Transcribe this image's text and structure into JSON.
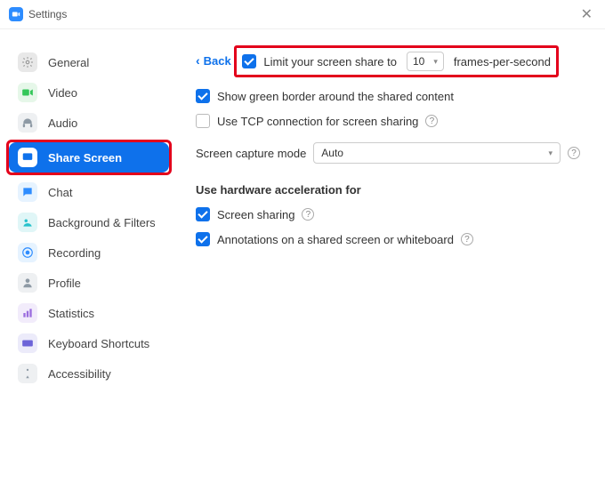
{
  "window": {
    "title": "Settings"
  },
  "sidebar": {
    "items": [
      {
        "label": "General"
      },
      {
        "label": "Video"
      },
      {
        "label": "Audio"
      },
      {
        "label": "Share Screen"
      },
      {
        "label": "Chat"
      },
      {
        "label": "Background & Filters"
      },
      {
        "label": "Recording"
      },
      {
        "label": "Profile"
      },
      {
        "label": "Statistics"
      },
      {
        "label": "Keyboard Shortcuts"
      },
      {
        "label": "Accessibility"
      }
    ]
  },
  "content": {
    "back": "Back",
    "limit_prefix": "Limit your screen share to",
    "limit_value": "10",
    "limit_suffix": "frames-per-second",
    "green_border": "Show green border around the shared content",
    "use_tcp": "Use TCP connection for screen sharing",
    "capture_mode_label": "Screen capture mode",
    "capture_mode_value": "Auto",
    "hw_accel_header": "Use hardware acceleration for",
    "hw_screen_sharing": "Screen sharing",
    "hw_annotations": "Annotations on a shared screen or whiteboard"
  }
}
